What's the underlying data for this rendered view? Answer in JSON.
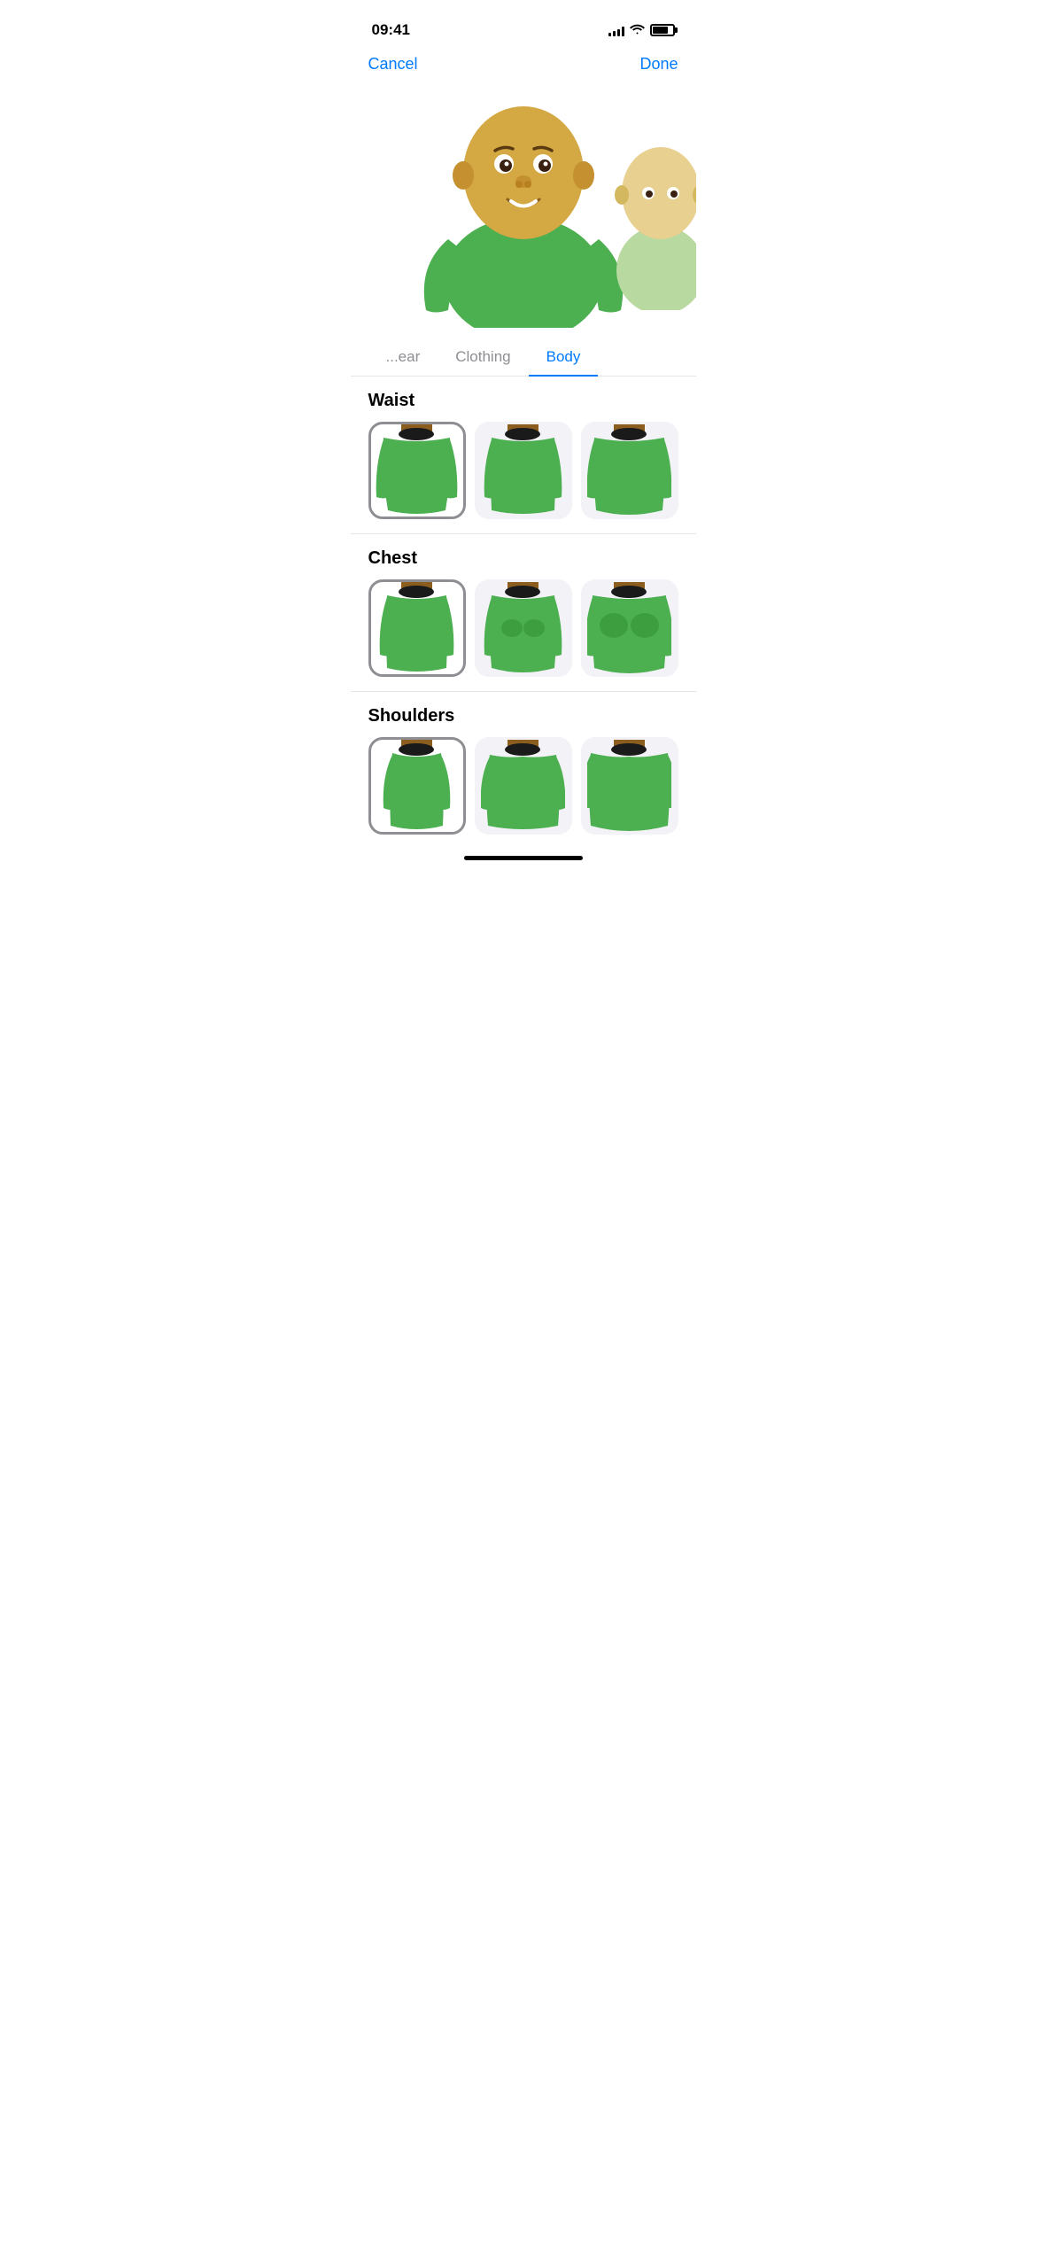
{
  "statusBar": {
    "time": "09:41",
    "signalBars": [
      4,
      6,
      8,
      10,
      12
    ],
    "battery": 80
  },
  "nav": {
    "cancelLabel": "Cancel",
    "doneLabel": "Done"
  },
  "tabs": [
    {
      "id": "headwear",
      "label": "...ear",
      "active": false
    },
    {
      "id": "clothing",
      "label": "Clothing",
      "active": false
    },
    {
      "id": "body",
      "label": "Body",
      "active": true
    }
  ],
  "sections": [
    {
      "id": "waist",
      "title": "Waist",
      "items": [
        {
          "selected": true
        },
        {
          "selected": false
        },
        {
          "selected": false
        }
      ]
    },
    {
      "id": "chest",
      "title": "Chest",
      "items": [
        {
          "selected": true
        },
        {
          "selected": false
        },
        {
          "selected": false
        }
      ]
    },
    {
      "id": "shoulders",
      "title": "Shoulders",
      "items": [
        {
          "selected": true
        },
        {
          "selected": false
        },
        {
          "selected": false
        }
      ]
    }
  ],
  "homeIndicator": true
}
